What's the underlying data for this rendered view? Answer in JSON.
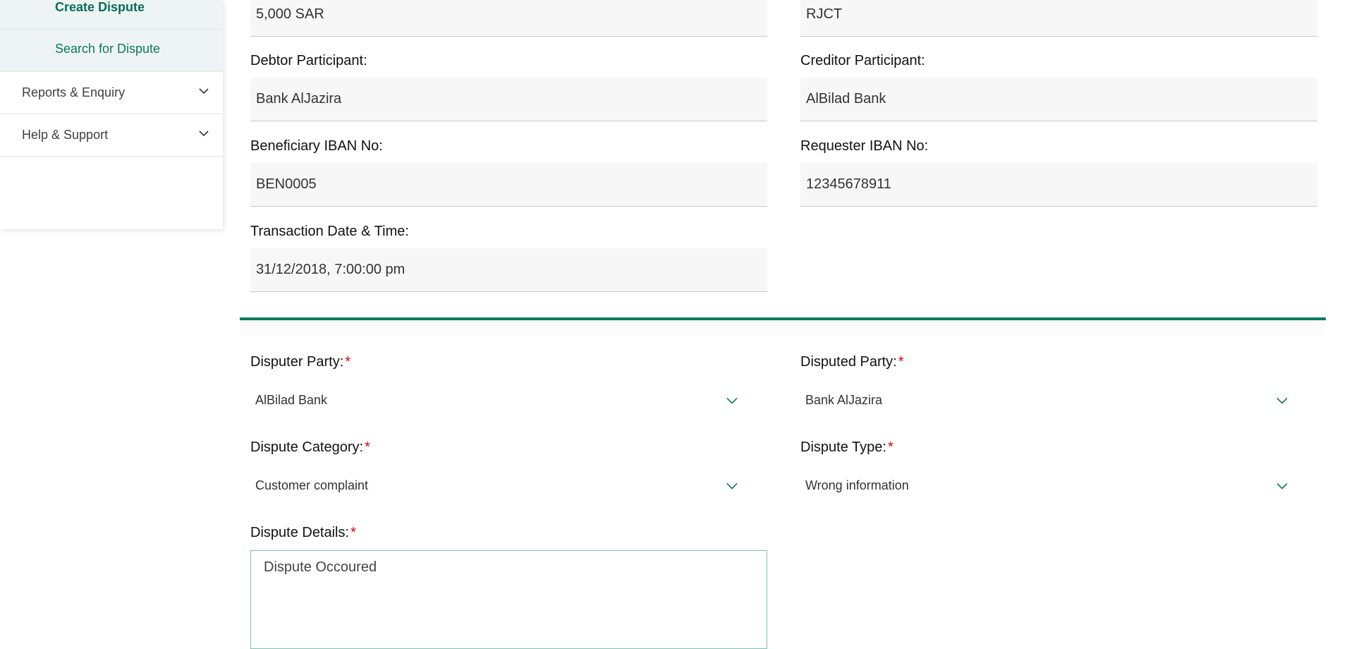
{
  "sidebar": {
    "sub_items": [
      {
        "label": "Create Dispute"
      },
      {
        "label": "Search for Dispute"
      }
    ],
    "menu_items": [
      {
        "label": "Reports & Enquiry"
      },
      {
        "label": "Help & Support"
      }
    ]
  },
  "transaction": {
    "amount_value": "5,000 SAR",
    "status_value": "RJCT",
    "debtor_label": "Debtor Participant:",
    "debtor_value": "Bank AlJazira",
    "creditor_label": "Creditor Participant:",
    "creditor_value": "AlBilad Bank",
    "beneficiary_iban_label": "Beneficiary IBAN No:",
    "beneficiary_iban_value": "BEN0005",
    "requester_iban_label": "Requester IBAN No:",
    "requester_iban_value": "12345678911",
    "datetime_label": "Transaction Date & Time:",
    "datetime_value": "31/12/2018, 7:00:00 pm"
  },
  "dispute": {
    "disputer_party_label": "Disputer Party:",
    "disputer_party_value": "AlBilad Bank",
    "disputed_party_label": "Disputed Party:",
    "disputed_party_value": "Bank AlJazira",
    "category_label": "Dispute Category:",
    "category_value": "Customer complaint",
    "type_label": "Dispute Type:",
    "type_value": "Wrong information",
    "details_label": "Dispute Details:",
    "details_value": "Dispute Occoured",
    "required_mark": "*"
  },
  "colors": {
    "accent": "#0b7a5e",
    "required": "#e00000"
  },
  "icons": {
    "menu_chevron": "chevron-down-icon",
    "select_chevron": "chevron-down-icon"
  }
}
